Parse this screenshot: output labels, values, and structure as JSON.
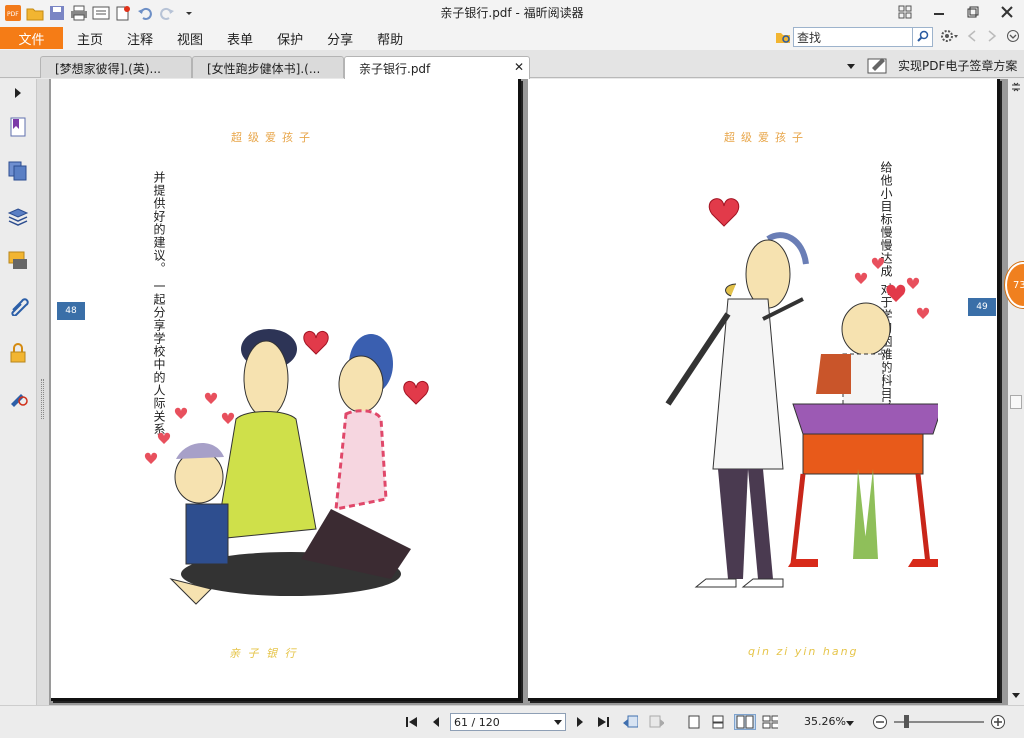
{
  "window": {
    "title": "亲子银行.pdf - 福昕阅读器"
  },
  "menu": {
    "file": "文件",
    "items": [
      "主页",
      "注释",
      "视图",
      "表单",
      "保护",
      "分享",
      "帮助"
    ]
  },
  "search": {
    "placeholder": "查找"
  },
  "tabs": [
    {
      "label": "[梦想家彼得].(英)..."
    },
    {
      "label": "[女性跑步健体书].(..."
    },
    {
      "label": "亲子银行.pdf"
    }
  ],
  "promo": {
    "label": "实现PDF电子签章方案"
  },
  "left_page": {
    "header": "超级爱孩子",
    "vertical_text_1": "并提供好的建议。",
    "vertical_text_2": "一起分享学校中的人际关系，",
    "page_number": "48",
    "footer": "亲 子 银 行"
  },
  "right_page": {
    "header": "超级爱孩子",
    "vertical_text_1": "给他小目标慢慢达成",
    "vertical_text_2": "对于学习困难的科目，",
    "page_number": "49",
    "footer": "qin zi yin hang"
  },
  "badge": "73",
  "status": {
    "page_field": "61 / 120",
    "zoom": "35.26%"
  }
}
